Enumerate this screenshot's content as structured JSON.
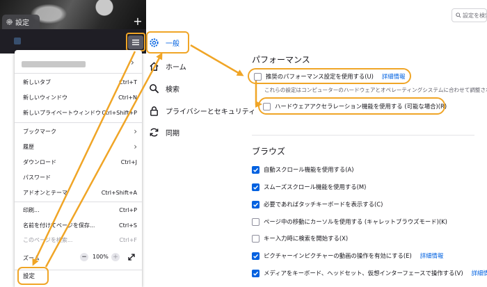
{
  "browser": {
    "tab_label": "設定",
    "new_tab_symbol": "+"
  },
  "app_menu": {
    "items": [
      {
        "label": "新しいタブ",
        "shortcut": "Ctrl+T"
      },
      {
        "label": "新しいウィンドウ",
        "shortcut": "Ctrl+N"
      },
      {
        "label": "新しいプライベートウィンドウ",
        "shortcut": "Ctrl+Shift+P"
      },
      {
        "label": "ブックマーク",
        "shortcut": ""
      },
      {
        "label": "履歴",
        "shortcut": ""
      },
      {
        "label": "ダウンロード",
        "shortcut": "Ctrl+J"
      },
      {
        "label": "パスワード",
        "shortcut": ""
      },
      {
        "label": "アドオンとテーマ",
        "shortcut": "Ctrl+Shift+A"
      },
      {
        "label": "印刷...",
        "shortcut": "Ctrl+P"
      },
      {
        "label": "名前を付けてページを保存...",
        "shortcut": "Ctrl+S"
      },
      {
        "label": "このページを検索...",
        "shortcut": "Ctrl+F"
      }
    ],
    "zoom_label": "ズーム",
    "zoom_minus": "−",
    "zoom_value": "100%",
    "zoom_plus": "+",
    "settings_label": "設定"
  },
  "settings": {
    "search_placeholder": "設定を検索",
    "categories": [
      {
        "label": "一般",
        "icon": "gear-icon"
      },
      {
        "label": "ホーム",
        "icon": "home-icon"
      },
      {
        "label": "検索",
        "icon": "search-icon"
      },
      {
        "label": "プライバシーとセキュリティ",
        "icon": "lock-icon"
      },
      {
        "label": "同期",
        "icon": "sync-icon"
      }
    ],
    "performance": {
      "title": "パフォーマンス",
      "recommended_label": "推奨のパフォーマンス設定を使用する(U)",
      "recommended_checked": false,
      "learn_more": "詳細情報",
      "note": "これらの設定はコンピューターのハードウェアとオペレーティングシステムに合わせて調整されます。",
      "hw_accel_label": "ハードウェアアクセラレーション機能を使用する (可能な場合)(R)",
      "hw_accel_checked": false
    },
    "browsing": {
      "title": "ブラウズ",
      "options": [
        {
          "label": "自動スクロール機能を使用する(A)",
          "checked": true,
          "link": ""
        },
        {
          "label": "スムーズスクロール機能を使用する(M)",
          "checked": true,
          "link": ""
        },
        {
          "label": "必要であればタッチキーボードを表示する(C)",
          "checked": true,
          "link": ""
        },
        {
          "label": "ページ中の移動にカーソルを使用する (キャレットブラウズモード)(K)",
          "checked": false,
          "link": ""
        },
        {
          "label": "キー入力時に検索を開始する(X)",
          "checked": false,
          "link": ""
        },
        {
          "label": "ピクチャーインピクチャーの動画の操作を有効にする(E)",
          "checked": true,
          "link": "詳細情報"
        },
        {
          "label": "メディアをキーボード、ヘッドセット、仮想インターフェースで操作する(V)",
          "checked": true,
          "link": "詳細情報"
        }
      ]
    }
  },
  "colors": {
    "highlight": "#f0a526",
    "accent": "#0061e0"
  }
}
